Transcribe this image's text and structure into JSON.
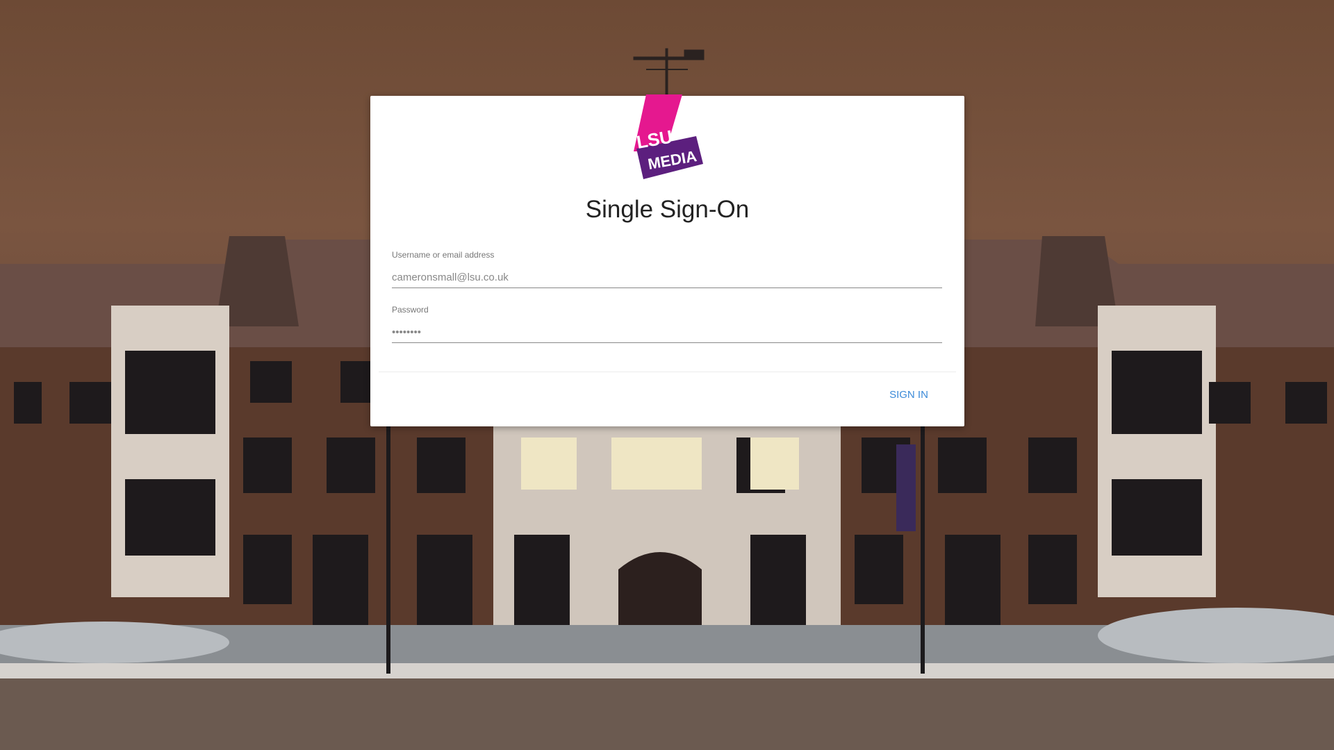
{
  "logo": {
    "line1": "LSU",
    "line2": "MEDIA",
    "colors": {
      "ribbon": "#e5188f",
      "box": "#5c1f7e",
      "text": "#ffffff"
    }
  },
  "title": "Single Sign-On",
  "form": {
    "username": {
      "label": "Username or email address",
      "value": "cameronsmall@lsu.co.uk"
    },
    "password": {
      "label": "Password",
      "value": "••••••••"
    },
    "submit_label": "SIGN IN"
  },
  "colors": {
    "accent": "#3b8ad8",
    "sky": "#6d4a35",
    "brick": "#5a3a2c"
  }
}
